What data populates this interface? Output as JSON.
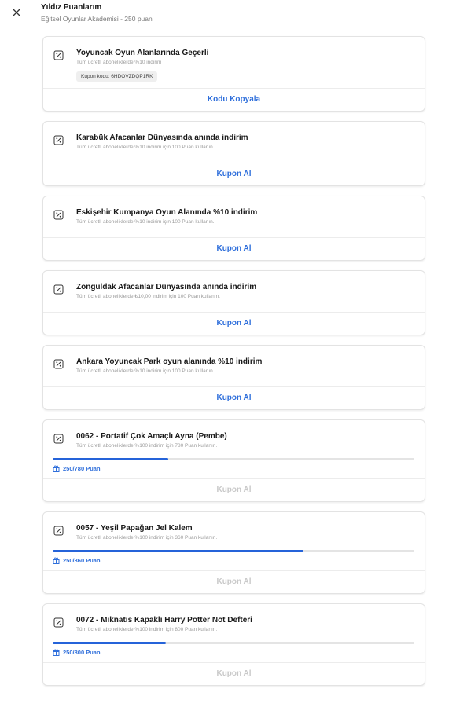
{
  "header": {
    "title": "Yıldız Puanlarım",
    "subtitle": "Eğitsel Oyunlar Akademisi - 250 puan"
  },
  "colors": {
    "accent": "#2f6fdb",
    "progress": "#2563d9",
    "disabled": "#c9c9c9"
  },
  "cards": [
    {
      "title": "Yoyuncak Oyun Alanlarında Geçerli",
      "desc": "Tüm ücretli aboneliklerde %10 indirim",
      "code": "Kupon kodu: 6HDOVZDQP1RK",
      "action": "Kodu Kopyala"
    },
    {
      "title": "Karabük Afacanlar Dünyasında anında indirim",
      "desc": "Tüm ücretli aboneliklerde %10 indirim için 100 Puan kullanın.",
      "action": "Kupon Al"
    },
    {
      "title": "Eskişehir Kumpanya Oyun Alanında %10 indirim",
      "desc": "Tüm ücretli aboneliklerde %10 indirim için 100 Puan kullanın.",
      "action": "Kupon Al"
    },
    {
      "title": "Zonguldak Afacanlar Dünyasında anında indirim",
      "desc": "Tüm ücretli aboneliklerde ₺10,00 indirim için 100 Puan kullanın.",
      "action": "Kupon Al"
    },
    {
      "title": "Ankara Yoyuncak Park oyun alanında %10 indirim",
      "desc": "Tüm ücretli aboneliklerde %10 indirim için 100 Puan kullanın.",
      "action": "Kupon Al"
    },
    {
      "title": "0062 - Portatif Çok Amaçlı Ayna (Pembe)",
      "desc": "Tüm ücretli aboneliklerde %100 indirim için 780 Puan kullanın.",
      "progress_label": "250/780 Puan",
      "progress": 0.3205,
      "action": "Kupon Al"
    },
    {
      "title": "0057 - Yeşil Papağan Jel Kalem",
      "desc": "Tüm ücretli aboneliklerde %100 indirim için 360 Puan kullanın.",
      "progress_label": "250/360 Puan",
      "progress": 0.6944,
      "action": "Kupon Al"
    },
    {
      "title": "0072 - Mıknatıs Kapaklı Harry Potter Not Defteri",
      "desc": "Tüm ücretli aboneliklerde %100 indirim için 800 Puan kullanın.",
      "progress_label": "250/800 Puan",
      "progress": 0.3125,
      "action": "Kupon Al"
    }
  ]
}
